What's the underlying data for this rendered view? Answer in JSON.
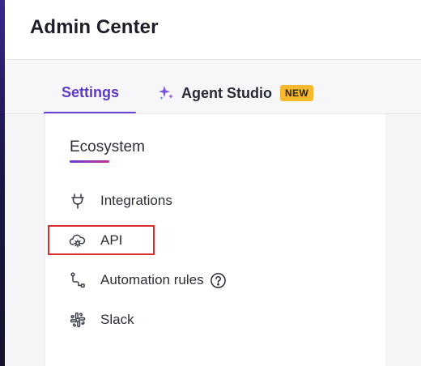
{
  "header": {
    "title": "Admin Center"
  },
  "tabs": [
    {
      "label": "Settings",
      "active": true
    },
    {
      "label": "Agent Studio",
      "badge": "NEW",
      "icon": "sparkle-icon"
    }
  ],
  "section": {
    "title": "Ecosystem",
    "items": [
      {
        "label": "Integrations",
        "icon": "plug-icon"
      },
      {
        "label": "API",
        "icon": "cloud-gear-icon",
        "highlighted": true
      },
      {
        "label": "Automation rules",
        "icon": "flow-icon",
        "help_icon": "help-circle-icon"
      },
      {
        "label": "Slack",
        "icon": "slack-icon"
      }
    ]
  },
  "colors": {
    "accent": "#5b39c9",
    "badge": "#f6b82c",
    "highlight_border": "#d9302e"
  }
}
